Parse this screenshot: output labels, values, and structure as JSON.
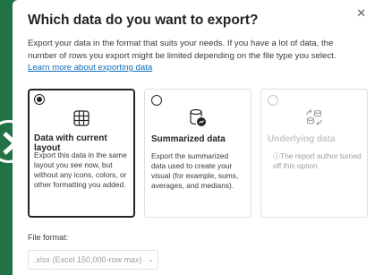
{
  "dialog": {
    "title": "Which data do you want to export?",
    "close_glyph": "✕",
    "description": "Export your data in the format that suits your needs. If you have a lot of data, the number of rows you export might be limited depending on the file type you select.",
    "learn_more": "Learn more about exporting data"
  },
  "options": [
    {
      "title": "Data with current layout",
      "text": "Export this data in the same layout you see now, but without any icons, colors, or other formatting you added.",
      "selected": true,
      "enabled": true,
      "icon": "table-grid-icon"
    },
    {
      "title": "Summarized data",
      "text": "Export the summarized data used to create your visual (for example, sums, averages, and medians).",
      "selected": false,
      "enabled": true,
      "icon": "database-chart-icon"
    },
    {
      "title": "Underlying data",
      "text": "The report author turned off this option",
      "selected": false,
      "enabled": false,
      "icon": "data-transfer-icon"
    }
  ],
  "format": {
    "label": "File format:",
    "value": ".xlsx (Excel 150,000-row max)"
  },
  "colors": {
    "accent": "#217346",
    "link": "#0f6cbd",
    "text": "#252423"
  }
}
